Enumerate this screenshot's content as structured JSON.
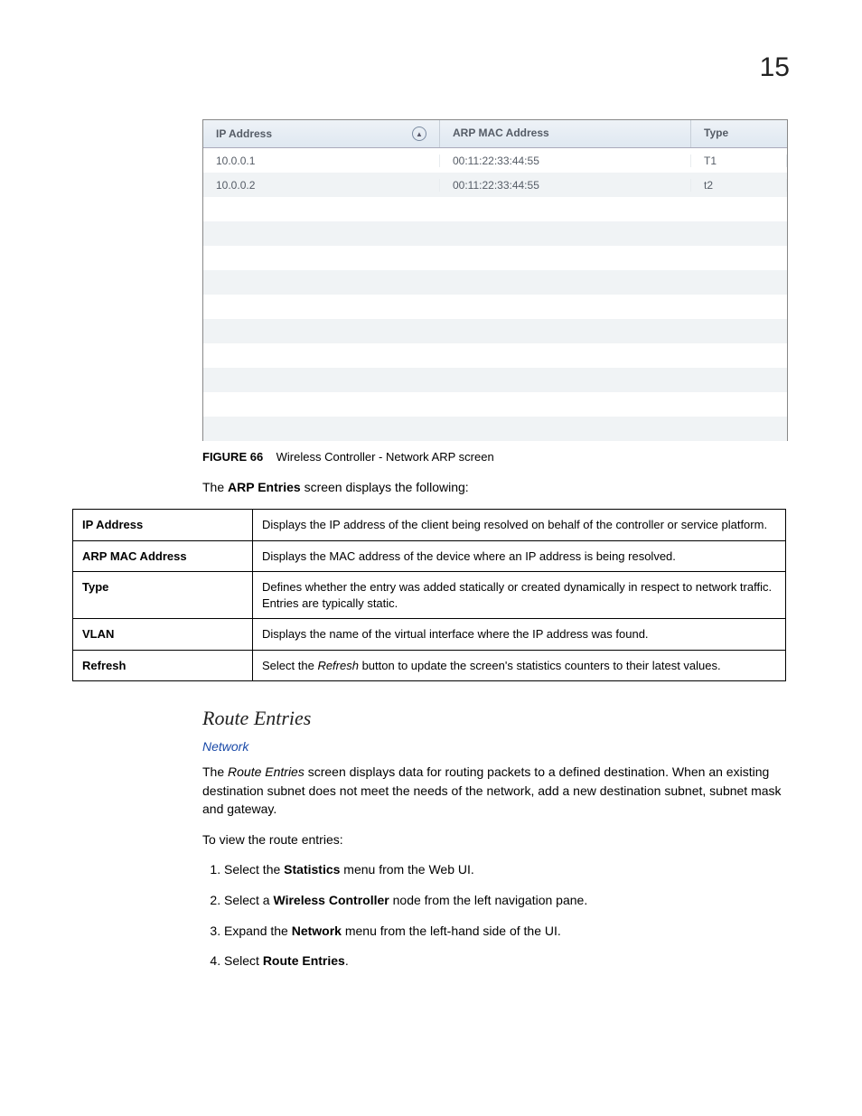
{
  "pageNumber": "15",
  "screenshot": {
    "columns": {
      "ip": "IP Address",
      "mac": "ARP MAC Address",
      "type": "Type"
    },
    "rows": [
      {
        "ip": "10.0.0.1",
        "mac": "00:11:22:33:44:55",
        "type": "T1"
      },
      {
        "ip": "10.0.0.2",
        "mac": "00:11:22:33:44:55",
        "type": "t2"
      }
    ],
    "emptyRows": 10
  },
  "figure": {
    "label": "FIGURE 66",
    "caption": "Wireless Controller - Network ARP screen"
  },
  "intro": {
    "prefix": "The ",
    "bold": "ARP Entries",
    "suffix": " screen displays the following:"
  },
  "definitions": [
    {
      "key": "IP Address",
      "val": "Displays the IP address of the client being resolved on behalf of the controller or service platform."
    },
    {
      "key": "ARP MAC Address",
      "val": "Displays the MAC address of the device where an IP address is being resolved."
    },
    {
      "key": "Type",
      "val": "Defines whether the entry was added statically or created dynamically in respect to network traffic. Entries are typically static."
    },
    {
      "key": "VLAN",
      "val": "Displays the name of the virtual interface where the IP address was found."
    },
    {
      "key": "Refresh",
      "valPrefix": "Select the ",
      "valItalic": "Refresh",
      "valSuffix": " button to update the screen's statistics counters to their latest values."
    }
  ],
  "section": {
    "title": "Route Entries",
    "link": "Network",
    "para1Prefix": "The ",
    "para1Italic": "Route Entries",
    "para1Suffix": " screen displays data for routing packets to a defined destination. When an existing destination subnet does not meet the needs of the network, add a new destination subnet, subnet mask and gateway.",
    "para2": "To view the route entries:",
    "steps": [
      {
        "pre": "Select the ",
        "bold": "Statistics",
        "post": " menu from the Web UI."
      },
      {
        "pre": "Select a ",
        "bold": "Wireless Controller",
        "post": " node from the left navigation pane."
      },
      {
        "pre": "Expand the ",
        "bold": "Network",
        "post": " menu from the left-hand side of the UI."
      },
      {
        "pre": "Select ",
        "bold": "Route Entries",
        "post": "."
      }
    ]
  }
}
